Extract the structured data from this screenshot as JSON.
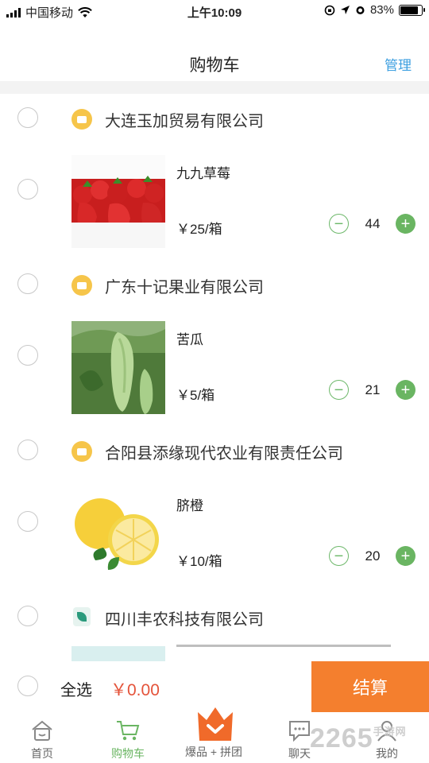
{
  "status_bar": {
    "carrier": "中国移动",
    "time": "上午10:09",
    "battery": "83%",
    "battery_level": 0.83
  },
  "header": {
    "title": "购物车",
    "manage": "管理"
  },
  "shops": [
    {
      "name": "大连玉加贸易有限公司",
      "icon": "shop-badge-icon",
      "item": {
        "name": "九九草莓",
        "price": "￥25/箱",
        "quantity": "44",
        "image": "strawberry"
      }
    },
    {
      "name": "广东十记果业有限公司",
      "icon": "shop-badge-icon",
      "item": {
        "name": "苦瓜",
        "price": "￥5/箱",
        "quantity": "21",
        "image": "bitter-melon"
      }
    },
    {
      "name": "合阳县添缘现代农业有限责任公司",
      "icon": "shop-badge-icon",
      "item": {
        "name": "脐橙",
        "price": "￥10/箱",
        "quantity": "20",
        "image": "navel-orange"
      }
    },
    {
      "name": "四川丰农科技有限公司",
      "icon": "shop-logo-icon"
    }
  ],
  "checkout": {
    "select_all": "全选",
    "total": "￥0.00",
    "button": "结算"
  },
  "tabs": [
    {
      "label": "首页",
      "icon": "home-icon"
    },
    {
      "label": "购物车",
      "icon": "cart-icon",
      "active": true
    },
    {
      "label": "爆品 + 拼团",
      "icon": "crown-icon"
    },
    {
      "label": "聊天",
      "icon": "chat-icon"
    },
    {
      "label": "我的",
      "icon": "profile-icon"
    }
  ],
  "watermark": {
    "text": "2265",
    "suffix": "手游网"
  },
  "colors": {
    "accent_green": "#6ab562",
    "checkout_orange": "#f47f2e",
    "price_red": "#e4533a",
    "link_blue": "#3c9fe0",
    "badge_yellow": "#f6c54a"
  }
}
